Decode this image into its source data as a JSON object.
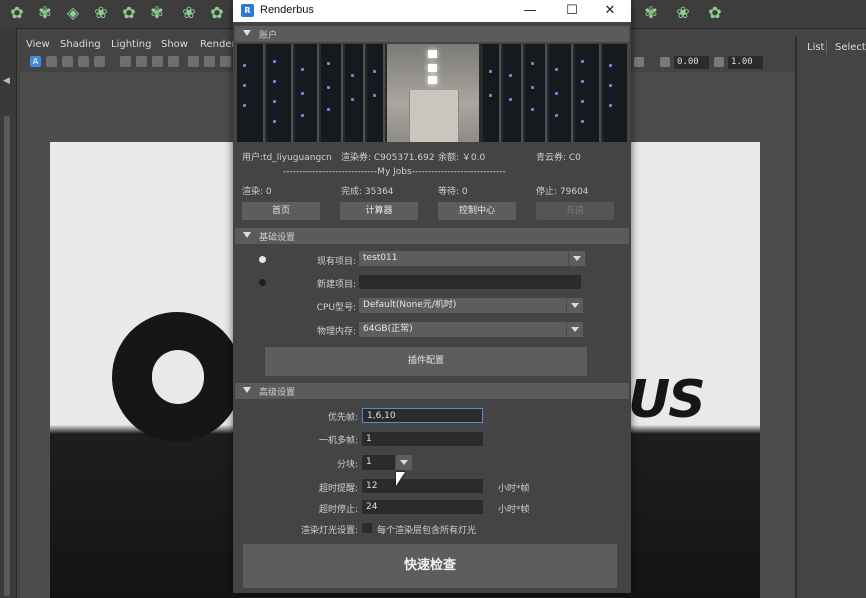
{
  "workspace": {
    "viewport_menu": [
      "View",
      "Shading",
      "Lighting",
      "Show",
      "Render"
    ],
    "field_a": "0.00",
    "field_b": "1.00",
    "outliner_tabs": [
      "List",
      "Selecte"
    ]
  },
  "dialog": {
    "title": "Renderbus",
    "window_buttons": {
      "minimize": "—",
      "maximize": "☐",
      "close": "✕"
    },
    "account": {
      "header": "账户",
      "user": "用户:td_liyuguangcn",
      "render_credit": "渲染券: C905371.692",
      "balance": "余额: ￥0.0",
      "green_credit": "青云券: C0",
      "myjobs": "-----------------------------My Jobs-----------------------------",
      "stats": {
        "rendering": "渲染: 0",
        "done": "完成: 35364",
        "waiting": "等待: 0",
        "stopped": "停止: 79604"
      },
      "buttons": {
        "home": "首页",
        "calculator": "计算器",
        "control": "控制中心",
        "recharge": "充值"
      }
    },
    "basic": {
      "header": "基础设置",
      "existing_project_label": "现有项目:",
      "existing_project_value": "test011",
      "new_project_label": "新建项目:",
      "new_project_value": "",
      "cpu_label": "CPU型号:",
      "cpu_value": "Default(None元/机时)",
      "memory_label": "物理内存:",
      "memory_value": "64GB(正常)",
      "plugin_button": "插件配置"
    },
    "advanced": {
      "header": "高级设置",
      "priority_label": "优先帧:",
      "priority_value": "1,6,10",
      "multiframe_label": "一机多帧:",
      "multiframe_value": "1",
      "blocks_label": "分块:",
      "blocks_value": "1",
      "timeout_remind_label": "超时提醒:",
      "timeout_remind_value": "12",
      "timeout_remind_unit": "小时*帧",
      "timeout_stop_label": "超时停止:",
      "timeout_stop_value": "24",
      "timeout_stop_unit": "小时*帧",
      "light_label": "渲染灯光设置:",
      "light_checkbox_text": "每个渲染层包含所有灯光"
    },
    "quick_check": "快速检查"
  },
  "colors": {
    "dialog_bg": "#444444",
    "section_header": "#5b5b5b",
    "button": "#5d5d5d",
    "field": "#2b2b2b",
    "shelf_icon": "#8ed08e"
  }
}
